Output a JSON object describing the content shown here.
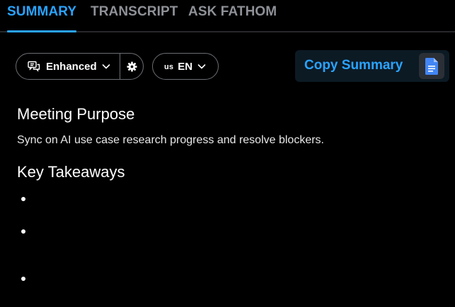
{
  "tabs": [
    {
      "label": "SUMMARY",
      "active": true
    },
    {
      "label": "TRANSCRIPT",
      "active": false
    },
    {
      "label": "ASK FATHOM",
      "active": false
    }
  ],
  "toolbar": {
    "mode_label": "Enhanced",
    "language_flag": "us",
    "language_label": "EN",
    "copy_label": "Copy Summary"
  },
  "content": {
    "purpose_heading": "Meeting Purpose",
    "purpose_text": "Sync on AI use case research progress and resolve blockers.",
    "takeaways_heading": "Key Takeaways",
    "takeaways": [
      "",
      "",
      ""
    ]
  },
  "colors": {
    "accent": "#2aa3ff",
    "background": "#000000",
    "inactive_tab": "#8e9197"
  }
}
